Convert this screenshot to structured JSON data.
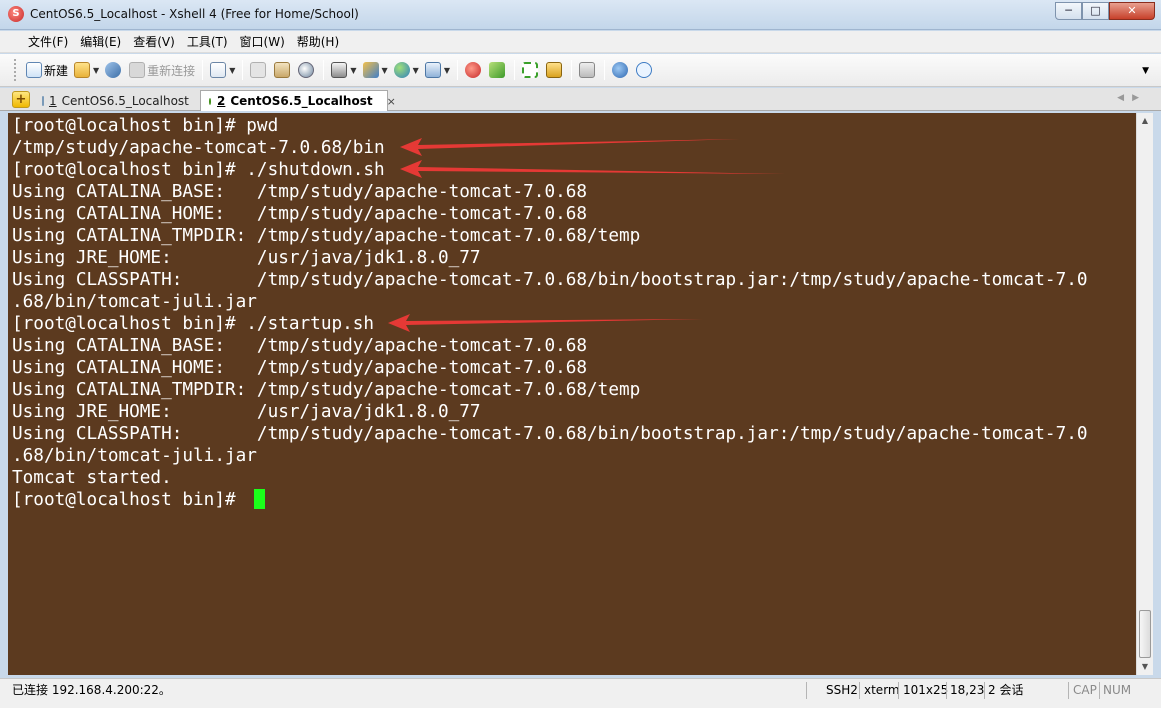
{
  "window": {
    "title": "CentOS6.5_Localhost - Xshell 4 (Free for Home/School)",
    "minimize": "─",
    "maximize": "□",
    "close": "✕"
  },
  "menu": [
    "文件(F)",
    "编辑(E)",
    "查看(V)",
    "工具(T)",
    "窗口(W)",
    "帮助(H)"
  ],
  "toolbar": {
    "new_label": "新建",
    "reconnect_label": "重新连接"
  },
  "tabs": [
    {
      "number": "1",
      "label": "CentOS6.5_Localhost"
    },
    {
      "number": "2",
      "label": "CentOS6.5_Localhost",
      "close": "×"
    }
  ],
  "terminal": {
    "lines": [
      "[root@localhost bin]# pwd",
      "/tmp/study/apache-tomcat-7.0.68/bin",
      "[root@localhost bin]# ./shutdown.sh",
      "Using CATALINA_BASE:   /tmp/study/apache-tomcat-7.0.68",
      "Using CATALINA_HOME:   /tmp/study/apache-tomcat-7.0.68",
      "Using CATALINA_TMPDIR: /tmp/study/apache-tomcat-7.0.68/temp",
      "Using JRE_HOME:        /usr/java/jdk1.8.0_77",
      "Using CLASSPATH:       /tmp/study/apache-tomcat-7.0.68/bin/bootstrap.jar:/tmp/study/apache-tomcat-7.0",
      ".68/bin/tomcat-juli.jar",
      "[root@localhost bin]# ./startup.sh",
      "Using CATALINA_BASE:   /tmp/study/apache-tomcat-7.0.68",
      "Using CATALINA_HOME:   /tmp/study/apache-tomcat-7.0.68",
      "Using CATALINA_TMPDIR: /tmp/study/apache-tomcat-7.0.68/temp",
      "Using JRE_HOME:        /usr/java/jdk1.8.0_77",
      "Using CLASSPATH:       /tmp/study/apache-tomcat-7.0.68/bin/bootstrap.jar:/tmp/study/apache-tomcat-7.0",
      ".68/bin/tomcat-juli.jar",
      "Tomcat started.",
      "[root@localhost bin]# "
    ],
    "background": "#5c3a1f",
    "foreground": "#ffffff",
    "cursor_color": "#1aff1a",
    "annotation_arrow_color": "#e53935"
  },
  "statusbar": {
    "connection": "已连接 192.168.4.200:22。",
    "protocol": "SSH2",
    "terminal_type": "xterm",
    "size": "101x25",
    "cursor_pos": "18,23",
    "sessions": "2 会话",
    "caps": "CAP",
    "num": "NUM"
  }
}
